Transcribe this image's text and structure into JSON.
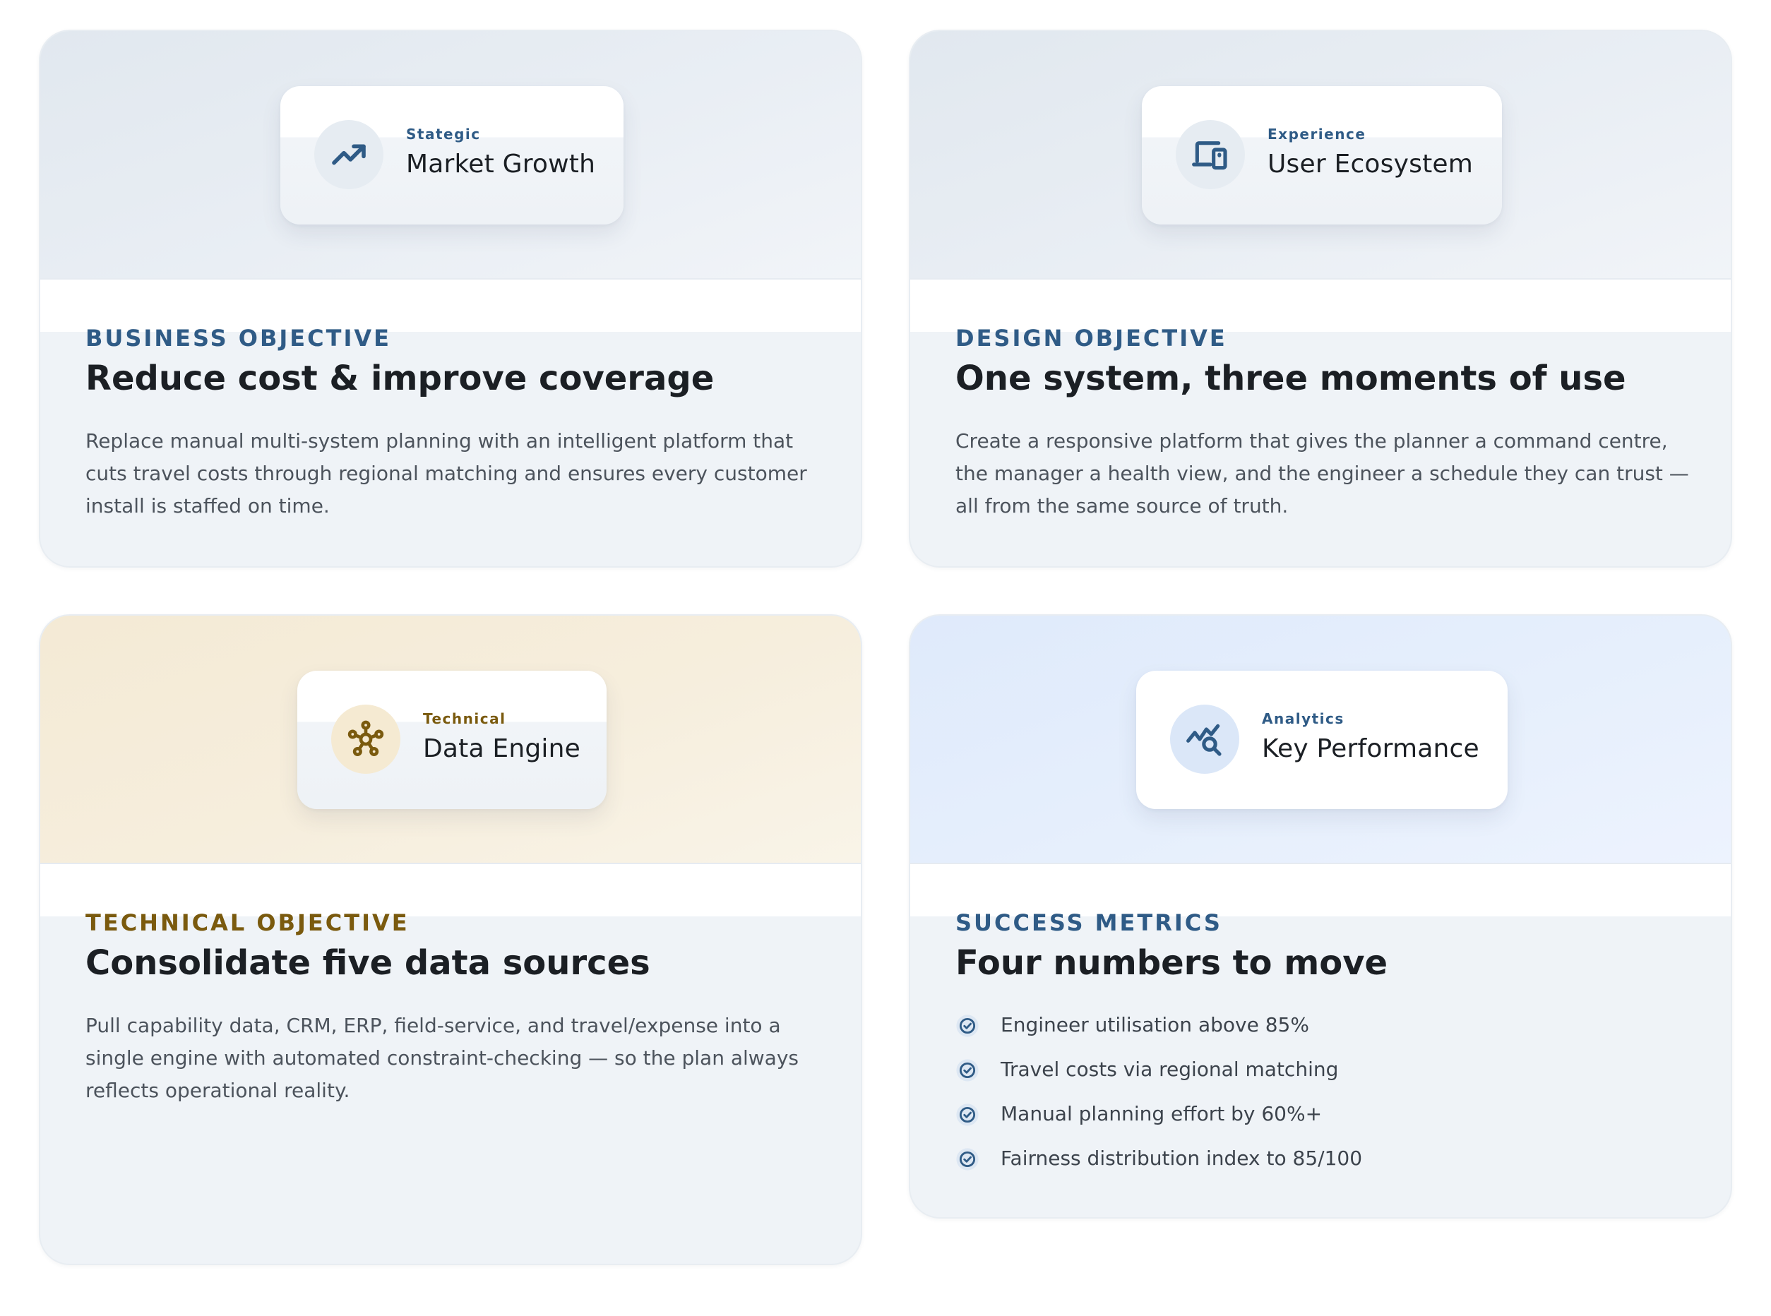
{
  "cards": {
    "business": {
      "chip_kicker": "Stategic",
      "chip_title": "Market Growth",
      "chip_icon": "trending-up-icon",
      "eyebrow": "BUSINESS OBJECTIVE",
      "heading": "Reduce cost & improve coverage",
      "body": "Replace manual multi-system planning with an intelligent platform that cuts travel costs through regional matching and ensures every customer install is staffed on time."
    },
    "design": {
      "chip_kicker": "Experience",
      "chip_title": "User Ecosystem",
      "chip_icon": "devices-icon",
      "eyebrow": "DESIGN OBJECTIVE",
      "heading": "One system, three moments of use",
      "body": "Create a responsive platform that gives the planner a command centre, the manager a health view, and the engineer a schedule they can trust — all from the same source of truth."
    },
    "technical": {
      "chip_kicker": "Technical",
      "chip_title": "Data Engine",
      "chip_icon": "hub-network-icon",
      "eyebrow": "TECHNICAL OBJECTIVE",
      "heading": "Consolidate five data sources",
      "body": "Pull capability data, CRM, ERP, field-service, and travel/expense into a single engine with automated constraint-checking — so the plan always reflects operational reality."
    },
    "metrics": {
      "chip_kicker": "Analytics",
      "chip_title": "Key Performance",
      "chip_icon": "query-stats-icon",
      "eyebrow": "SUCCESS METRICS",
      "heading": "Four numbers to move",
      "items": [
        "Engineer utilisation above 85%",
        "Travel costs via regional matching",
        "Manual planning effort by 60%+",
        "Fairness distribution index to 85/100"
      ]
    }
  },
  "colors": {
    "accent_blue": "#2f5b86",
    "accent_gold": "#7a5a0e",
    "heading": "#1b1f24",
    "body": "#4c535c"
  }
}
